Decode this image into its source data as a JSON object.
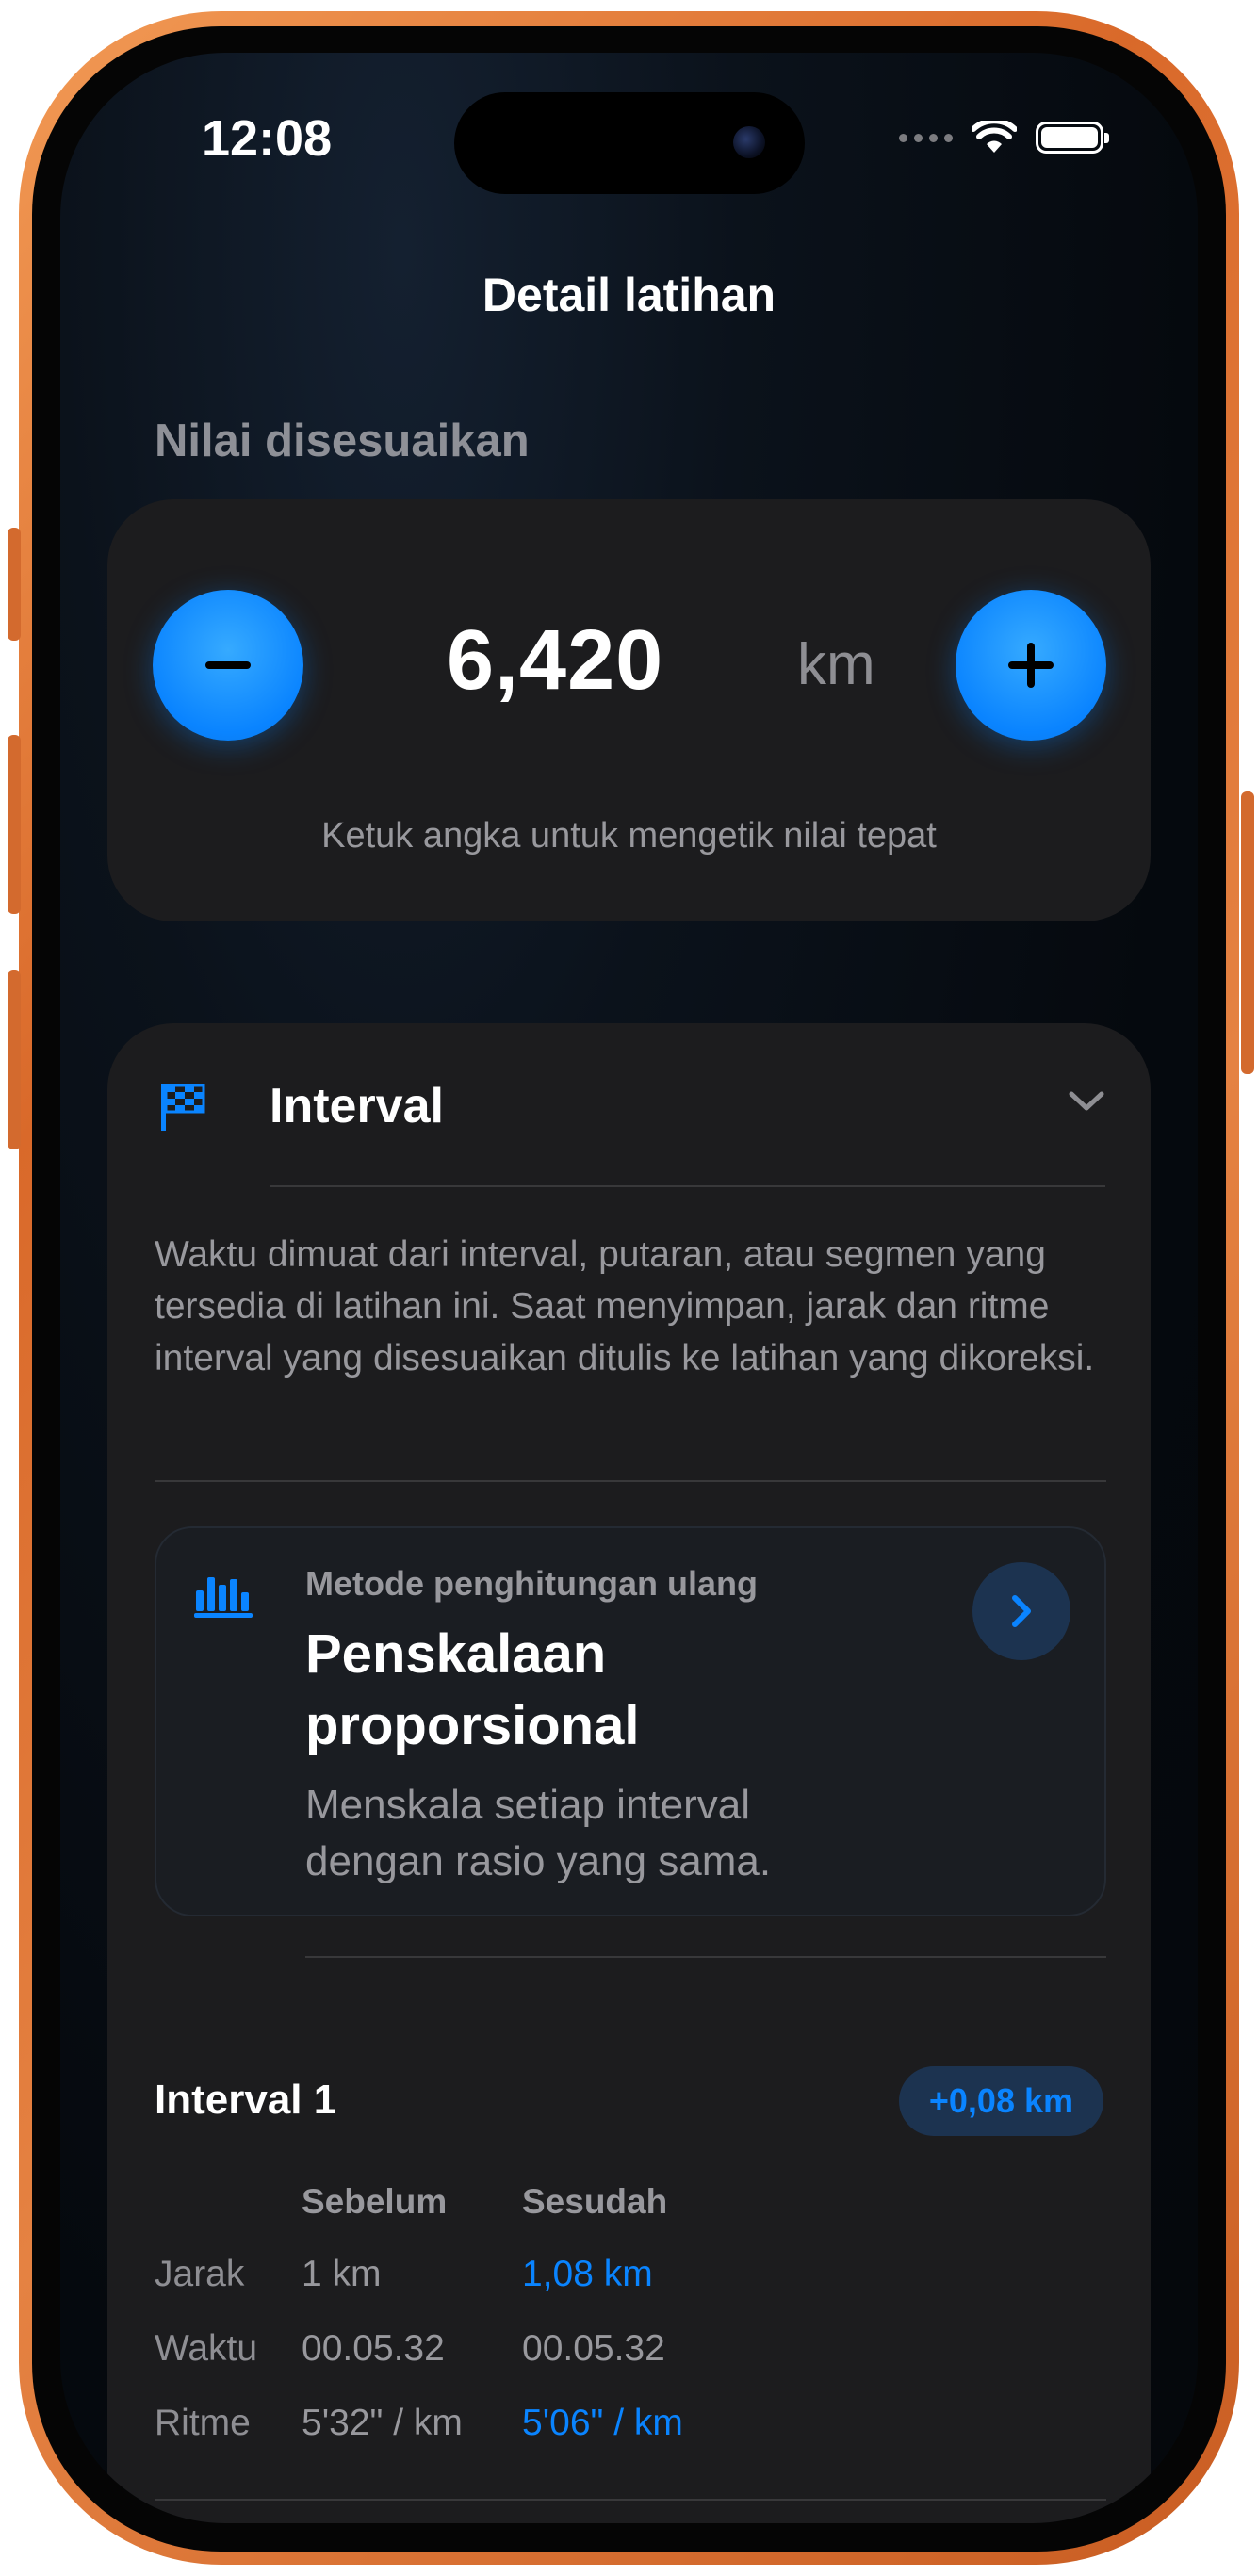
{
  "status_bar": {
    "time": "12:08"
  },
  "nav": {
    "title": "Detail latihan"
  },
  "adjust": {
    "section_label": "Nilai disesuaikan",
    "value": "6,420",
    "unit": "km",
    "hint": "Ketuk angka untuk mengetik nilai tepat",
    "minus_icon": "minus-icon",
    "plus_icon": "plus-icon"
  },
  "interval_section": {
    "title": "Interval",
    "icon": "checkered-flag-icon",
    "description": "Waktu dimuat dari interval, putaran, atau segmen yang tersedia di latihan ini. Saat menyimpan, jarak dan ritme interval yang disesuaikan ditulis ke latihan yang dikoreksi.",
    "method": {
      "kicker": "Metode penghitungan ulang",
      "title": "Penskalaan proporsional",
      "subtitle": "Menskala setiap interval dengan rasio yang sama.",
      "icon": "bar-chart-icon"
    },
    "intervals": [
      {
        "title": "Interval 1",
        "delta": "+0,08 km",
        "header_before": "Sebelum",
        "header_after": "Sesudah",
        "rows": [
          {
            "label": "Jarak",
            "before": "1 km",
            "after": "1,08 km",
            "after_changed": true
          },
          {
            "label": "Waktu",
            "before": "00.05.32",
            "after": "00.05.32",
            "after_changed": false
          },
          {
            "label": "Ritme",
            "before": "5'32\" / km",
            "after": "5'06\" / km",
            "after_changed": true
          }
        ]
      }
    ]
  },
  "colors": {
    "accent": "#0a84ff",
    "card": "#1c1c1e",
    "frame": "#e07a3a"
  }
}
